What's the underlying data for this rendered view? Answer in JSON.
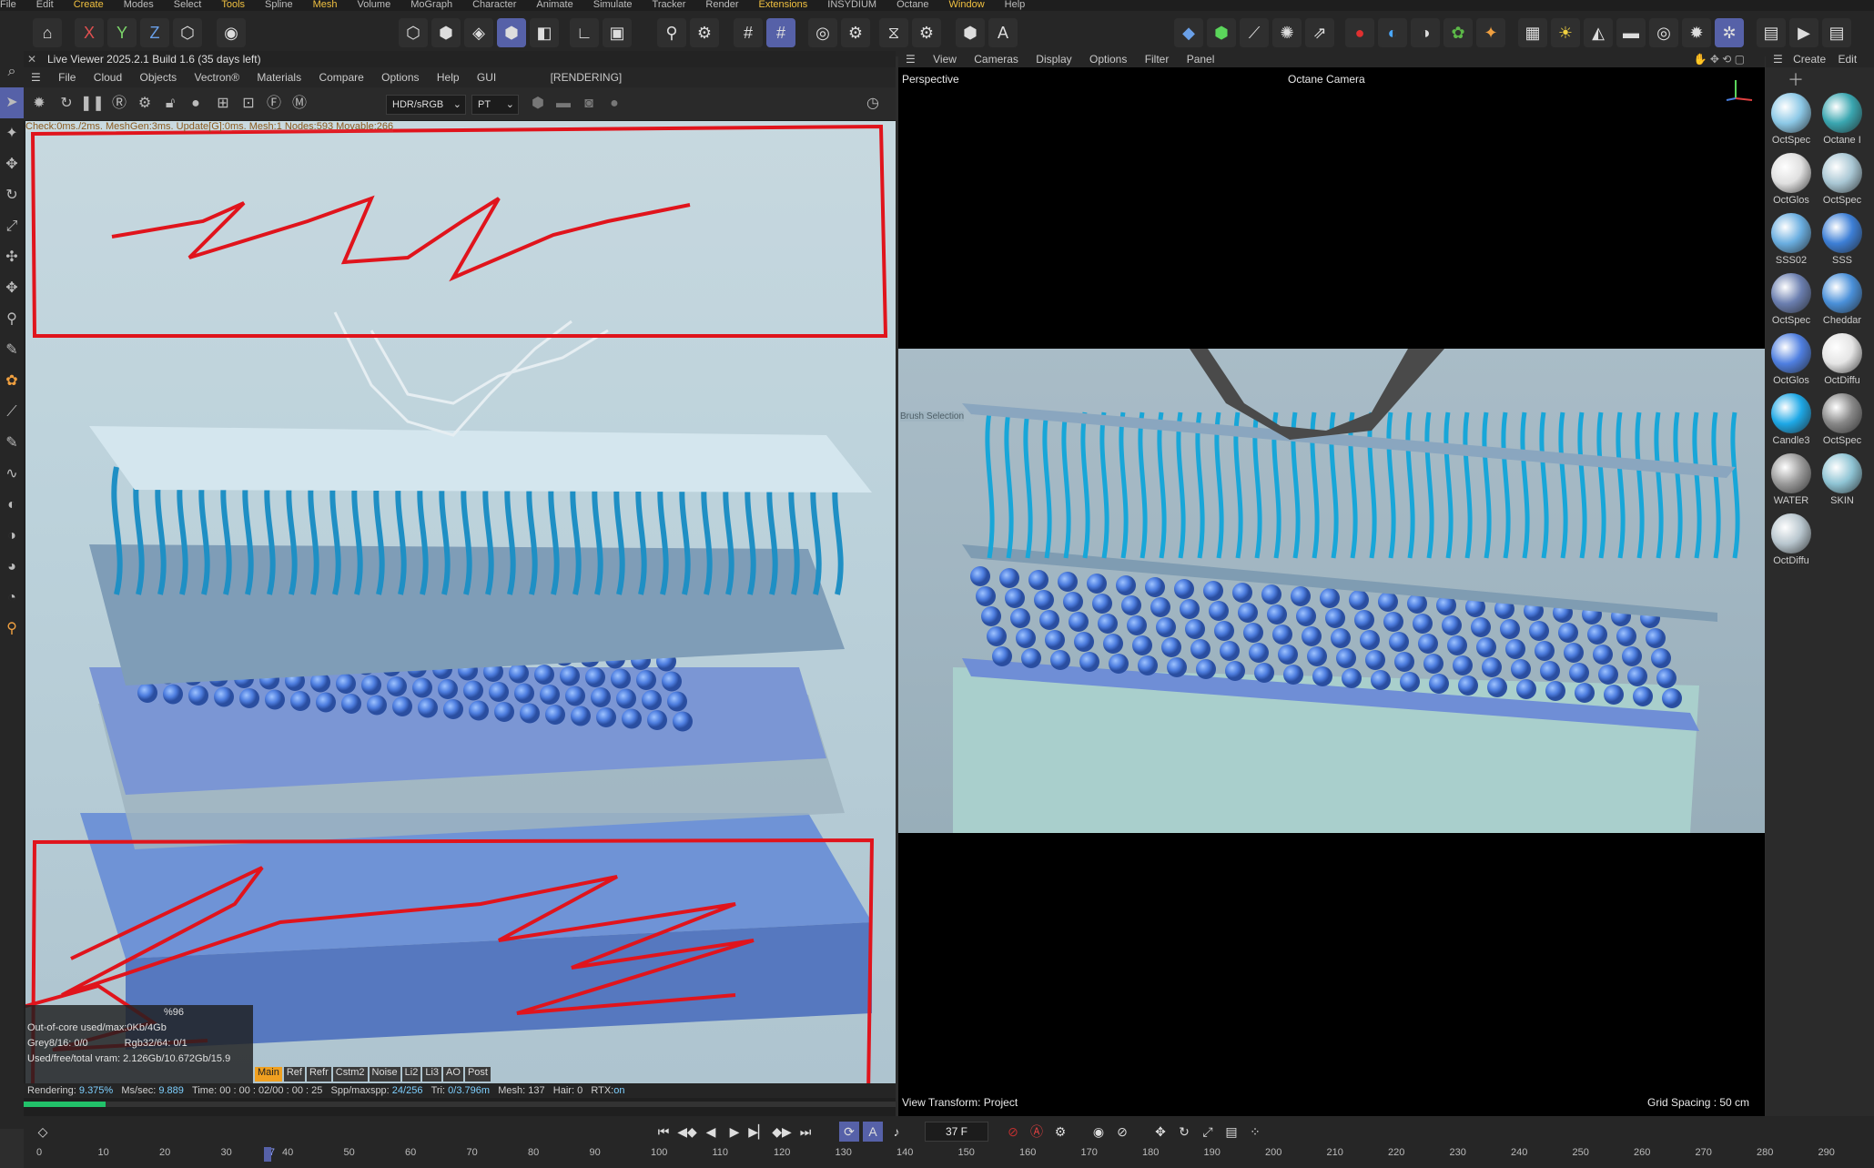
{
  "menubar": [
    "File",
    "Edit",
    "Create",
    "Modes",
    "Select",
    "Tools",
    "Spline",
    "Mesh",
    "Volume",
    "MoGraph",
    "Character",
    "Animate",
    "Simulate",
    "Tracker",
    "Render",
    "Extensions",
    "INSYDIUM",
    "Octane",
    "Window",
    "Help"
  ],
  "menubar_highlight": [
    "Create",
    "Tools",
    "Mesh",
    "Extensions",
    "Window"
  ],
  "toolbar": {
    "axis_x": "X",
    "axis_y": "Y",
    "axis_z": "Z"
  },
  "live_viewer": {
    "title": "Live Viewer 2025.2.1 Build 1.6 (35 days left)",
    "menus": [
      "File",
      "Cloud",
      "Objects",
      "Vectron®",
      "Materials",
      "Compare",
      "Options",
      "Help",
      "GUI"
    ],
    "status_tag": "[RENDERING]",
    "color_space": "HDR/sRGB",
    "kernel": "PT",
    "check_line": "Check:0ms./2ms. MeshGen:3ms. Update[G]:0ms. Mesh:1 Nodes:593 Movable:266",
    "pct": "%96",
    "out_of_core": "Out-of-core used/max:0Kb/4Gb",
    "grey": "Grey8/16: 0/0",
    "rgb": "Rgb32/64: 0/1",
    "vram": "Used/free/total vram: 2.126Gb/10.672Gb/15.9",
    "passes": [
      "Main",
      "Ref",
      "Refr",
      "Cstm2",
      "Noise",
      "Li2",
      "Li3",
      "AO",
      "Post"
    ],
    "rendering_label": "Rendering:",
    "rendering_pct": "9.375%",
    "mssec_label": "Ms/sec:",
    "mssec": "9.889",
    "time_label": "Time:",
    "time": "00 : 00 : 02/00 : 00 : 25",
    "spp_label": "Spp/maxspp:",
    "spp": "24/256",
    "tri_label": "Tri:",
    "tri": "0/3.796m",
    "mesh_label": "Mesh:",
    "mesh": "137",
    "hair_label": "Hair:",
    "hair": "0",
    "rtx_label": "RTX:",
    "rtx": "on",
    "progress": 0.094
  },
  "viewport": {
    "menus": [
      "View",
      "Cameras",
      "Display",
      "Options",
      "Filter",
      "Panel"
    ],
    "name": "Perspective",
    "camera": "Octane Camera",
    "brush": "Brush Selection",
    "view_transform": "View Transform: Project",
    "grid_spacing": "Grid Spacing : 50 cm"
  },
  "materials_panel": {
    "menus": [
      "Create",
      "Edit"
    ],
    "items": [
      {
        "label": "OctSpec",
        "color": "#8cc8e6"
      },
      {
        "label": "Octane I",
        "color": "#3aa6b0"
      },
      {
        "label": "OctGlos",
        "color": "#e0e0e0"
      },
      {
        "label": "OctSpec",
        "color": "#a9c7d4"
      },
      {
        "label": "SSS02",
        "color": "#6aaee0"
      },
      {
        "label": "SSS",
        "color": "#3d7fd6"
      },
      {
        "label": "OctSpec",
        "color": "#6b7fb0"
      },
      {
        "label": "Cheddar",
        "color": "#4a90d9"
      },
      {
        "label": "OctGlos",
        "color": "#4f7fe0"
      },
      {
        "label": "OctDiffu",
        "color": "#e5e5e5"
      },
      {
        "label": "Candle3",
        "color": "#1ea8e6"
      },
      {
        "label": "OctSpec",
        "color": "#888888"
      },
      {
        "label": "WATER",
        "color": "#9a9a9a"
      },
      {
        "label": "SKIN",
        "color": "#8fc4d4"
      },
      {
        "label": "OctDiffu",
        "color": "#b8c6ce"
      }
    ]
  },
  "timeline": {
    "frame": "37 F",
    "ticks": [
      "0",
      "10",
      "20",
      "30",
      "37",
      "40",
      "50",
      "60",
      "70",
      "80",
      "90",
      "100",
      "110",
      "120",
      "130",
      "140",
      "150",
      "160",
      "170",
      "180",
      "190",
      "200",
      "210",
      "220",
      "230",
      "240",
      "250",
      "260",
      "270",
      "280",
      "290"
    ]
  }
}
